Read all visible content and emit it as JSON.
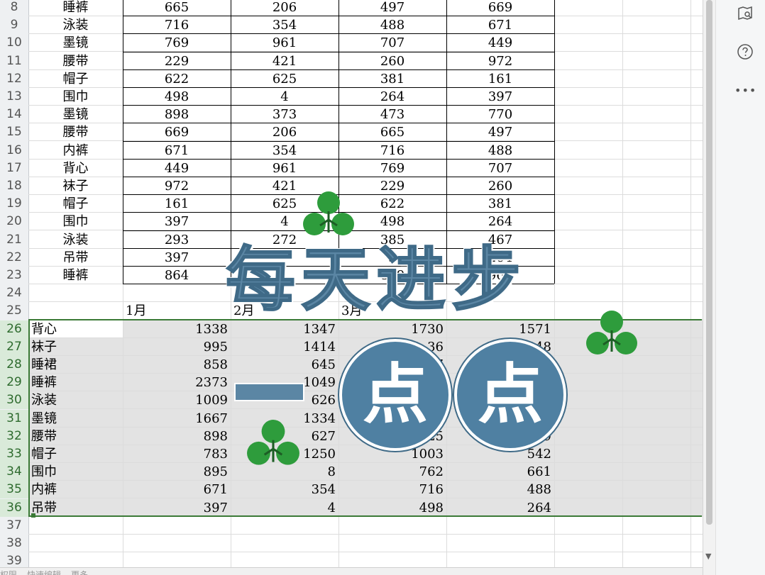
{
  "top_rows": [
    {
      "row": "8",
      "item": "睡裤",
      "v": [
        "665",
        "206",
        "497",
        "669"
      ]
    },
    {
      "row": "9",
      "item": "泳装",
      "v": [
        "716",
        "354",
        "488",
        "671"
      ]
    },
    {
      "row": "10",
      "item": "墨镜",
      "v": [
        "769",
        "961",
        "707",
        "449"
      ]
    },
    {
      "row": "11",
      "item": "腰带",
      "v": [
        "229",
        "421",
        "260",
        "972"
      ]
    },
    {
      "row": "12",
      "item": "帽子",
      "v": [
        "622",
        "625",
        "381",
        "161"
      ]
    },
    {
      "row": "13",
      "item": "围巾",
      "v": [
        "498",
        "4",
        "264",
        "397"
      ]
    },
    {
      "row": "14",
      "item": "墨镜",
      "v": [
        "898",
        "373",
        "473",
        "770"
      ]
    },
    {
      "row": "15",
      "item": "腰带",
      "v": [
        "669",
        "206",
        "665",
        "497"
      ]
    },
    {
      "row": "16",
      "item": "内裤",
      "v": [
        "671",
        "354",
        "716",
        "488"
      ]
    },
    {
      "row": "17",
      "item": "背心",
      "v": [
        "449",
        "961",
        "769",
        "707"
      ]
    },
    {
      "row": "18",
      "item": "袜子",
      "v": [
        "972",
        "421",
        "229",
        "260"
      ]
    },
    {
      "row": "19",
      "item": "帽子",
      "v": [
        "161",
        "625",
        "622",
        "381"
      ]
    },
    {
      "row": "20",
      "item": "围巾",
      "v": [
        "397",
        "4",
        "498",
        "264"
      ]
    },
    {
      "row": "21",
      "item": "泳装",
      "v": [
        "293",
        "272",
        "385",
        "467"
      ]
    },
    {
      "row": "22",
      "item": "吊带",
      "v": [
        "397",
        "",
        "3",
        "264"
      ]
    },
    {
      "row": "23",
      "item": "睡裤",
      "v": [
        "864",
        "",
        "889",
        "961"
      ]
    }
  ],
  "row24": {
    "row": "24"
  },
  "header_row": {
    "row": "25",
    "months": [
      "1月",
      "2月",
      "3月",
      ""
    ]
  },
  "summary_rows": [
    {
      "row": "26",
      "item": "背心",
      "v": [
        "1338",
        "1347",
        "1730",
        "1571"
      ]
    },
    {
      "row": "27",
      "item": "袜子",
      "v": [
        "995",
        "1414",
        "36",
        "48"
      ]
    },
    {
      "row": "28",
      "item": "睡裙",
      "v": [
        "858",
        "645",
        "7",
        ""
      ]
    },
    {
      "row": "29",
      "item": "睡裤",
      "v": [
        "2373",
        "1049",
        "",
        ""
      ]
    },
    {
      "row": "30",
      "item": "泳装",
      "v": [
        "1009",
        "626",
        "3",
        ""
      ]
    },
    {
      "row": "31",
      "item": "墨镜",
      "v": [
        "1667",
        "1334",
        "30",
        ""
      ]
    },
    {
      "row": "32",
      "item": "腰带",
      "v": [
        "898",
        "627",
        "925",
        "09"
      ]
    },
    {
      "row": "33",
      "item": "帽子",
      "v": [
        "783",
        "1250",
        "1003",
        "542"
      ]
    },
    {
      "row": "34",
      "item": "围巾",
      "v": [
        "895",
        "8",
        "762",
        "661"
      ]
    },
    {
      "row": "35",
      "item": "内裤",
      "v": [
        "671",
        "354",
        "716",
        "488"
      ]
    },
    {
      "row": "36",
      "item": "吊带",
      "v": [
        "397",
        "4",
        "498",
        "264"
      ]
    }
  ],
  "empty_rows": [
    "37",
    "38",
    "39"
  ],
  "overlay": {
    "title": "每天进步",
    "dash": "一",
    "circle1": "点",
    "circle2": "点",
    "color": "#5b86a4",
    "clover_color": "#2e9c3c"
  },
  "sheet_tabs": [
    "权限",
    "快速编辑",
    "更多"
  ],
  "right_toolbar": {
    "icons": [
      "map-search-icon",
      "help-icon",
      "more-icon"
    ]
  },
  "colors": {
    "selection_border": "#3b7a36",
    "selection_fill": "#e3e3e3"
  }
}
